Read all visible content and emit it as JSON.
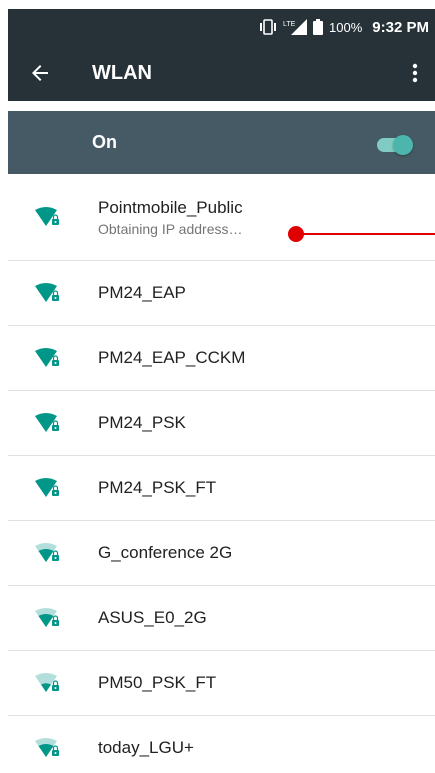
{
  "status_bar": {
    "battery_percent": "100%",
    "time": "9:32 PM",
    "network": "LTE"
  },
  "toolbar": {
    "title": "WLAN"
  },
  "wlan_switch": {
    "label": "On",
    "state": "on"
  },
  "networks": [
    {
      "ssid": "Pointmobile_Public",
      "summary": "Obtaining IP address…",
      "signal": "full",
      "secured": true
    },
    {
      "ssid": "PM24_EAP",
      "summary": "",
      "signal": "full",
      "secured": true
    },
    {
      "ssid": "PM24_EAP_CCKM",
      "summary": "",
      "signal": "full",
      "secured": true
    },
    {
      "ssid": "PM24_PSK",
      "summary": "",
      "signal": "full",
      "secured": true
    },
    {
      "ssid": "PM24_PSK_FT",
      "summary": "",
      "signal": "full",
      "secured": true
    },
    {
      "ssid": "G_conference 2G",
      "summary": "",
      "signal": "medium",
      "secured": true
    },
    {
      "ssid": "ASUS_E0_2G",
      "summary": "",
      "signal": "medium",
      "secured": true
    },
    {
      "ssid": "PM50_PSK_FT",
      "summary": "",
      "signal": "low",
      "secured": true
    },
    {
      "ssid": "today_LGU+",
      "summary": "",
      "signal": "medium",
      "secured": true
    }
  ],
  "colors": {
    "appbar": "#263238",
    "switchbar": "#455a64",
    "accent": "#009688",
    "annotation": "#e00000"
  }
}
